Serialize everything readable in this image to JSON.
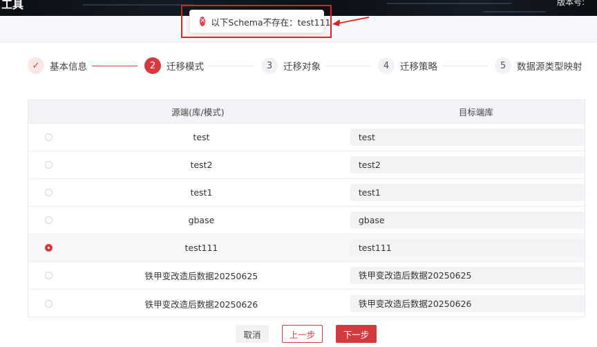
{
  "header": {
    "app_title": "工具",
    "version_label": "版本号:"
  },
  "toast": {
    "message": "以下Schema不存在：test111",
    "icon": "error-circle-icon"
  },
  "steps": [
    {
      "number": "✓",
      "label": "基本信息",
      "status": "done"
    },
    {
      "number": "2",
      "label": "迁移模式",
      "status": "active"
    },
    {
      "number": "3",
      "label": "迁移对象",
      "status": "wait"
    },
    {
      "number": "4",
      "label": "迁移策略",
      "status": "wait"
    },
    {
      "number": "5",
      "label": "数据源类型映射",
      "status": "wait"
    }
  ],
  "table": {
    "headers": {
      "source": "源端(库/模式)",
      "target": "目标端库"
    },
    "rows": [
      {
        "source": "test",
        "target": "test",
        "selected": false
      },
      {
        "source": "test2",
        "target": "test2",
        "selected": false
      },
      {
        "source": "test1",
        "target": "test1",
        "selected": false
      },
      {
        "source": "gbase",
        "target": "gbase",
        "selected": false
      },
      {
        "source": "test111",
        "target": "test111",
        "selected": true
      },
      {
        "source": "铁甲变改造后数据20250625",
        "target": "铁甲变改造后数据20250625",
        "selected": false
      },
      {
        "source": "铁甲变改造后数据20250626",
        "target": "铁甲变改造后数据20250626",
        "selected": false
      }
    ]
  },
  "buttons": {
    "cancel": "取消",
    "prev": "上一步",
    "next": "下一步"
  },
  "colors": {
    "accent": "#d9383f",
    "highlight_box": "#e02020"
  }
}
